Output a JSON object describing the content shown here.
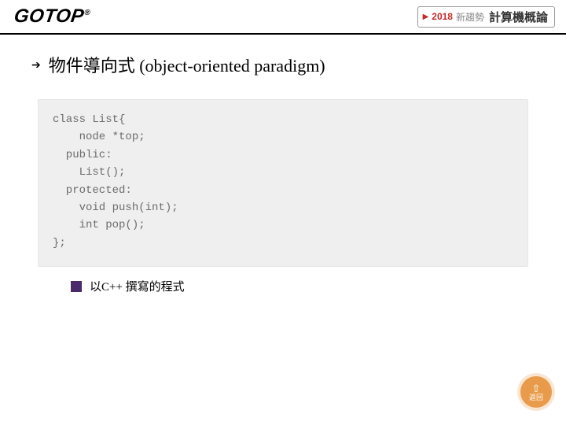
{
  "header": {
    "logo_text": "GOTOP",
    "logo_reg": "®",
    "badge": {
      "year": "2018",
      "trend": "新趨勢",
      "title": "計算機概論"
    }
  },
  "heading": "物件導向式 (object-oriented paradigm)",
  "code": "class List{\n    node *top;\n  public:\n    List();\n  protected:\n    void push(int);\n    int pop();\n};",
  "caption": "以C++ 撰寫的程式",
  "return_label": "返回"
}
